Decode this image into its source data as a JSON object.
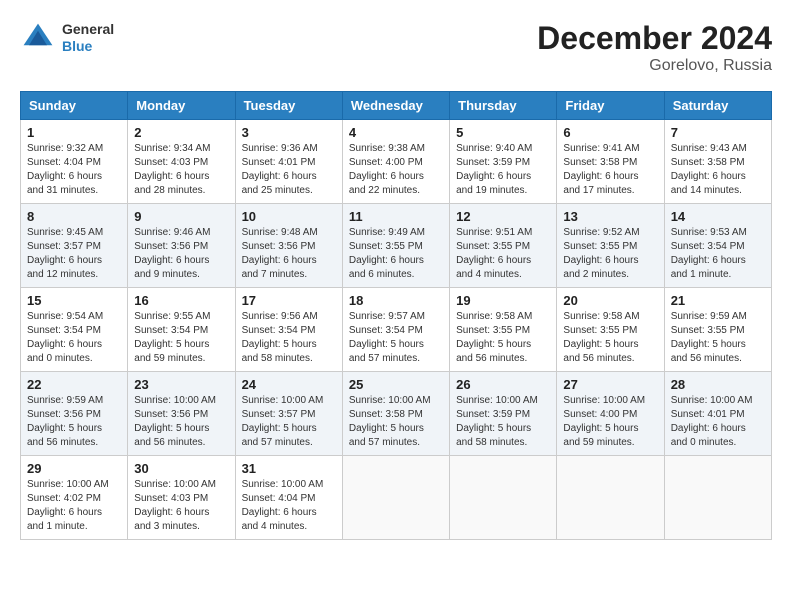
{
  "header": {
    "logo": {
      "line1": "General",
      "line2": "Blue"
    },
    "title": "December 2024",
    "subtitle": "Gorelovo, Russia"
  },
  "weekdays": [
    "Sunday",
    "Monday",
    "Tuesday",
    "Wednesday",
    "Thursday",
    "Friday",
    "Saturday"
  ],
  "weeks": [
    [
      {
        "day": "1",
        "sunrise": "Sunrise: 9:32 AM",
        "sunset": "Sunset: 4:04 PM",
        "daylight": "Daylight: 6 hours and 31 minutes."
      },
      {
        "day": "2",
        "sunrise": "Sunrise: 9:34 AM",
        "sunset": "Sunset: 4:03 PM",
        "daylight": "Daylight: 6 hours and 28 minutes."
      },
      {
        "day": "3",
        "sunrise": "Sunrise: 9:36 AM",
        "sunset": "Sunset: 4:01 PM",
        "daylight": "Daylight: 6 hours and 25 minutes."
      },
      {
        "day": "4",
        "sunrise": "Sunrise: 9:38 AM",
        "sunset": "Sunset: 4:00 PM",
        "daylight": "Daylight: 6 hours and 22 minutes."
      },
      {
        "day": "5",
        "sunrise": "Sunrise: 9:40 AM",
        "sunset": "Sunset: 3:59 PM",
        "daylight": "Daylight: 6 hours and 19 minutes."
      },
      {
        "day": "6",
        "sunrise": "Sunrise: 9:41 AM",
        "sunset": "Sunset: 3:58 PM",
        "daylight": "Daylight: 6 hours and 17 minutes."
      },
      {
        "day": "7",
        "sunrise": "Sunrise: 9:43 AM",
        "sunset": "Sunset: 3:58 PM",
        "daylight": "Daylight: 6 hours and 14 minutes."
      }
    ],
    [
      {
        "day": "8",
        "sunrise": "Sunrise: 9:45 AM",
        "sunset": "Sunset: 3:57 PM",
        "daylight": "Daylight: 6 hours and 12 minutes."
      },
      {
        "day": "9",
        "sunrise": "Sunrise: 9:46 AM",
        "sunset": "Sunset: 3:56 PM",
        "daylight": "Daylight: 6 hours and 9 minutes."
      },
      {
        "day": "10",
        "sunrise": "Sunrise: 9:48 AM",
        "sunset": "Sunset: 3:56 PM",
        "daylight": "Daylight: 6 hours and 7 minutes."
      },
      {
        "day": "11",
        "sunrise": "Sunrise: 9:49 AM",
        "sunset": "Sunset: 3:55 PM",
        "daylight": "Daylight: 6 hours and 6 minutes."
      },
      {
        "day": "12",
        "sunrise": "Sunrise: 9:51 AM",
        "sunset": "Sunset: 3:55 PM",
        "daylight": "Daylight: 6 hours and 4 minutes."
      },
      {
        "day": "13",
        "sunrise": "Sunrise: 9:52 AM",
        "sunset": "Sunset: 3:55 PM",
        "daylight": "Daylight: 6 hours and 2 minutes."
      },
      {
        "day": "14",
        "sunrise": "Sunrise: 9:53 AM",
        "sunset": "Sunset: 3:54 PM",
        "daylight": "Daylight: 6 hours and 1 minute."
      }
    ],
    [
      {
        "day": "15",
        "sunrise": "Sunrise: 9:54 AM",
        "sunset": "Sunset: 3:54 PM",
        "daylight": "Daylight: 6 hours and 0 minutes."
      },
      {
        "day": "16",
        "sunrise": "Sunrise: 9:55 AM",
        "sunset": "Sunset: 3:54 PM",
        "daylight": "Daylight: 5 hours and 59 minutes."
      },
      {
        "day": "17",
        "sunrise": "Sunrise: 9:56 AM",
        "sunset": "Sunset: 3:54 PM",
        "daylight": "Daylight: 5 hours and 58 minutes."
      },
      {
        "day": "18",
        "sunrise": "Sunrise: 9:57 AM",
        "sunset": "Sunset: 3:54 PM",
        "daylight": "Daylight: 5 hours and 57 minutes."
      },
      {
        "day": "19",
        "sunrise": "Sunrise: 9:58 AM",
        "sunset": "Sunset: 3:55 PM",
        "daylight": "Daylight: 5 hours and 56 minutes."
      },
      {
        "day": "20",
        "sunrise": "Sunrise: 9:58 AM",
        "sunset": "Sunset: 3:55 PM",
        "daylight": "Daylight: 5 hours and 56 minutes."
      },
      {
        "day": "21",
        "sunrise": "Sunrise: 9:59 AM",
        "sunset": "Sunset: 3:55 PM",
        "daylight": "Daylight: 5 hours and 56 minutes."
      }
    ],
    [
      {
        "day": "22",
        "sunrise": "Sunrise: 9:59 AM",
        "sunset": "Sunset: 3:56 PM",
        "daylight": "Daylight: 5 hours and 56 minutes."
      },
      {
        "day": "23",
        "sunrise": "Sunrise: 10:00 AM",
        "sunset": "Sunset: 3:56 PM",
        "daylight": "Daylight: 5 hours and 56 minutes."
      },
      {
        "day": "24",
        "sunrise": "Sunrise: 10:00 AM",
        "sunset": "Sunset: 3:57 PM",
        "daylight": "Daylight: 5 hours and 57 minutes."
      },
      {
        "day": "25",
        "sunrise": "Sunrise: 10:00 AM",
        "sunset": "Sunset: 3:58 PM",
        "daylight": "Daylight: 5 hours and 57 minutes."
      },
      {
        "day": "26",
        "sunrise": "Sunrise: 10:00 AM",
        "sunset": "Sunset: 3:59 PM",
        "daylight": "Daylight: 5 hours and 58 minutes."
      },
      {
        "day": "27",
        "sunrise": "Sunrise: 10:00 AM",
        "sunset": "Sunset: 4:00 PM",
        "daylight": "Daylight: 5 hours and 59 minutes."
      },
      {
        "day": "28",
        "sunrise": "Sunrise: 10:00 AM",
        "sunset": "Sunset: 4:01 PM",
        "daylight": "Daylight: 6 hours and 0 minutes."
      }
    ],
    [
      {
        "day": "29",
        "sunrise": "Sunrise: 10:00 AM",
        "sunset": "Sunset: 4:02 PM",
        "daylight": "Daylight: 6 hours and 1 minute."
      },
      {
        "day": "30",
        "sunrise": "Sunrise: 10:00 AM",
        "sunset": "Sunset: 4:03 PM",
        "daylight": "Daylight: 6 hours and 3 minutes."
      },
      {
        "day": "31",
        "sunrise": "Sunrise: 10:00 AM",
        "sunset": "Sunset: 4:04 PM",
        "daylight": "Daylight: 6 hours and 4 minutes."
      },
      null,
      null,
      null,
      null
    ]
  ]
}
